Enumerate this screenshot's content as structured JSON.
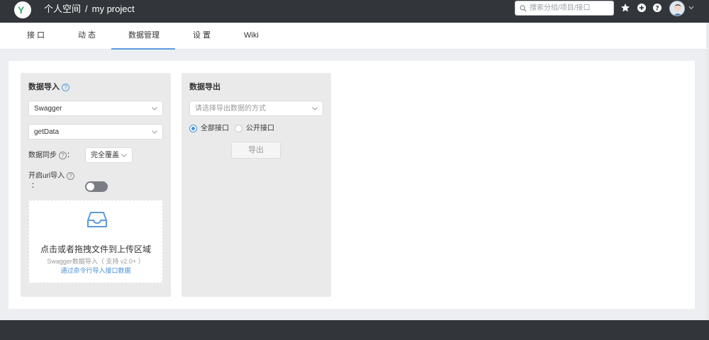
{
  "header": {
    "logo_letter": "Y",
    "breadcrumb_space": "个人空间",
    "breadcrumb_sep": "/",
    "breadcrumb_project": "my project",
    "search_placeholder": "搜索分组/项目/接口",
    "icons": [
      "star-icon",
      "plus-circle-icon",
      "question-icon",
      "avatar",
      "chevron-down-icon"
    ]
  },
  "tabs": [
    {
      "label": "接 口"
    },
    {
      "label": "动 态"
    },
    {
      "label": "数据管理",
      "active": true
    },
    {
      "label": "设 置"
    },
    {
      "label": "Wiki"
    }
  ],
  "import_card": {
    "title": "数据导入",
    "help_glyph": "?",
    "format_select": "Swagger",
    "mode_select": "getData",
    "sync_label": "数据同步",
    "sync_colon": "：",
    "sync_select": "完全覆盖",
    "url_import_label": "开启url导入",
    "url_import_colon": "：",
    "url_import_enabled": false,
    "drop_main": "点击或者拖拽文件到上传区域",
    "drop_hint": "Swagger数据导入（ 支持 v2.0+ ）",
    "drop_link": "通过命令行导入接口数据"
  },
  "export_card": {
    "title": "数据导出",
    "method_placeholder": "请选择导出数据的方式",
    "radio_all": "全部接口",
    "radio_public": "公开接口",
    "selected": "全部接口",
    "export_button": "导出"
  },
  "colors": {
    "topbar": "#32363a",
    "accent": "#4a8fdb",
    "card_bg": "#eaeaea"
  }
}
